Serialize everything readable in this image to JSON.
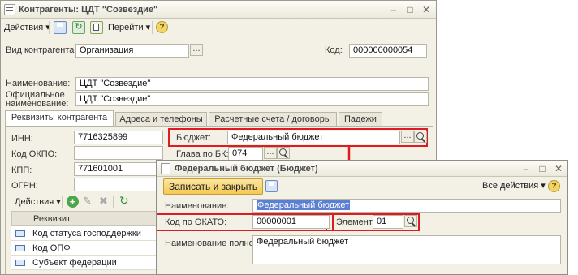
{
  "main_window": {
    "title": "Контрагенты: ЦДТ \"Созвездие\"",
    "toolbar": {
      "actions_label": "Действия",
      "goto_label": "Перейти",
      "help_label": "?"
    },
    "fields": {
      "kind_label": "Вид контрагента:",
      "kind_value": "Организация",
      "code_label": "Код:",
      "code_value": "000000000054",
      "name_label": "Наименование:",
      "name_value": "ЦДТ \"Созвездие\"",
      "official_name_label_1": "Официальное",
      "official_name_label_2": "наименование:",
      "official_name_value": "ЦДТ \"Созвездие\""
    },
    "tabs": [
      {
        "label": "Реквизиты контрагента",
        "active": true
      },
      {
        "label": "Адреса и телефоны",
        "active": false
      },
      {
        "label": "Расчетные счета / договоры",
        "active": false
      },
      {
        "label": "Падежи",
        "active": false
      }
    ],
    "requisites": {
      "inn_label": "ИНН:",
      "inn_value": "7716325899",
      "okpo_label": "Код ОКПО:",
      "okpo_value": "",
      "kpp_label": "КПП:",
      "kpp_value": "771601001",
      "ogrn_label": "ОГРН:",
      "ogrn_value": "",
      "budget_label": "Бюджет:",
      "budget_value": "Федеральный бюджет",
      "bk_head_label": "Глава по БК:",
      "bk_head_value": "074"
    },
    "grid": {
      "actions_label": "Действия",
      "column_header": "Реквизит",
      "rows": [
        "Код статуса господдержки",
        "Код ОПФ",
        "Субъект федерации"
      ]
    }
  },
  "popup_window": {
    "title": "Федеральный бюджет (Бюджет)",
    "write_close_label": "Записать и закрыть",
    "all_actions_label": "Все действия",
    "help_label": "?",
    "name_label": "Наименование:",
    "name_value": "Федеральный бюджет",
    "okato_label": "Код по ОКАТО:",
    "okato_value": "00000001",
    "element_label": "Элемент:",
    "element_value": "01",
    "full_name_label": "Наименование полное:",
    "full_name_value": "Федеральный бюджет"
  },
  "colors": {
    "highlight_red": "#e01a22",
    "window_bg": "#f3f1e6",
    "selection_blue": "#5b7fd3",
    "write_button": "#f3c955"
  },
  "icons": [
    "app-icon",
    "minimize-icon",
    "maximize-icon",
    "close-icon",
    "save-icon",
    "refresh-icon",
    "copy-icon",
    "add-icon",
    "edit-icon",
    "delete-icon",
    "search-icon",
    "help-icon",
    "arrow-down-icon"
  ]
}
